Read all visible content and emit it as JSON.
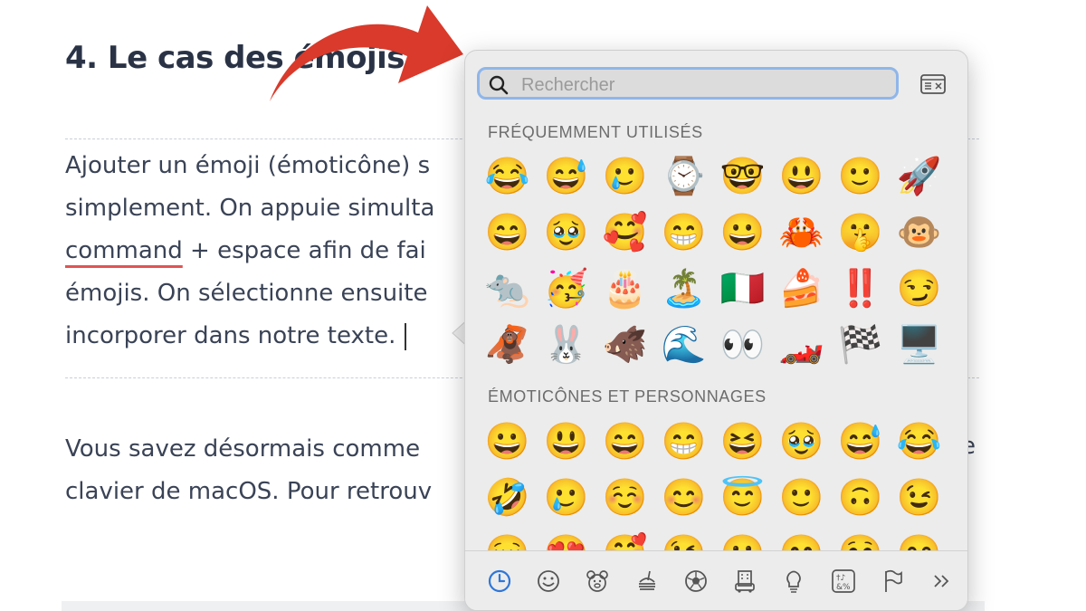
{
  "article": {
    "heading": "4. Le cas des émojis",
    "paragraph1": [
      "Ajouter un émoji (émoticône) s",
      "simplement. On appuie simulta",
      "command",
      " + espace afin de fai",
      "émojis. On sélectionne ensuite",
      "incorporer dans notre texte."
    ],
    "paragraph2": [
      "Vous savez désormais comme",
      "clavier de macOS. Pour retrouv"
    ],
    "paragraph2_right_fragment": "e",
    "underline_color": "#e05454"
  },
  "arrow": {
    "color": "#d93a2b"
  },
  "picker": {
    "search": {
      "placeholder": "Rechercher",
      "value": ""
    },
    "accent_color": "#8fb6ea",
    "sections": [
      {
        "label": "FRÉQUEMMENT UTILISÉS",
        "emojis": [
          "😂",
          "😅",
          "🥲",
          "⌚",
          "🤓",
          "😃",
          "🙂",
          "🚀",
          "😄",
          "🥹",
          "🥰",
          "😁",
          "😀",
          "🦀",
          "🤫",
          "🐵",
          "🐀",
          "🥳",
          "🎂",
          "🏝️",
          "🇮🇹",
          "🍰",
          "‼️",
          "😏",
          "🦧",
          "🐰",
          "🐗",
          "🌊",
          "👀",
          "🏎️",
          "🏁",
          "🖥️"
        ]
      },
      {
        "label": "ÉMOTICÔNES ET PERSONNAGES",
        "emojis": [
          "😀",
          "😃",
          "😄",
          "😁",
          "😆",
          "🥹",
          "😅",
          "😂",
          "🤣",
          "🥲",
          "☺️",
          "😊",
          "😇",
          "🙂",
          "🙃",
          "😉",
          "😌",
          "😍",
          "🥰",
          "😘",
          "😗",
          "😙",
          "😚",
          "😋"
        ]
      }
    ],
    "categories": [
      {
        "name": "recent-icon",
        "active": true
      },
      {
        "name": "smiley-icon",
        "active": false
      },
      {
        "name": "animal-icon",
        "active": false
      },
      {
        "name": "food-icon",
        "active": false
      },
      {
        "name": "soccer-ball-icon",
        "active": false
      },
      {
        "name": "building-icon",
        "active": false
      },
      {
        "name": "lightbulb-icon",
        "active": false
      },
      {
        "name": "symbols-icon",
        "active": false
      },
      {
        "name": "flag-icon",
        "active": false
      },
      {
        "name": "more-icon",
        "active": false
      }
    ]
  }
}
